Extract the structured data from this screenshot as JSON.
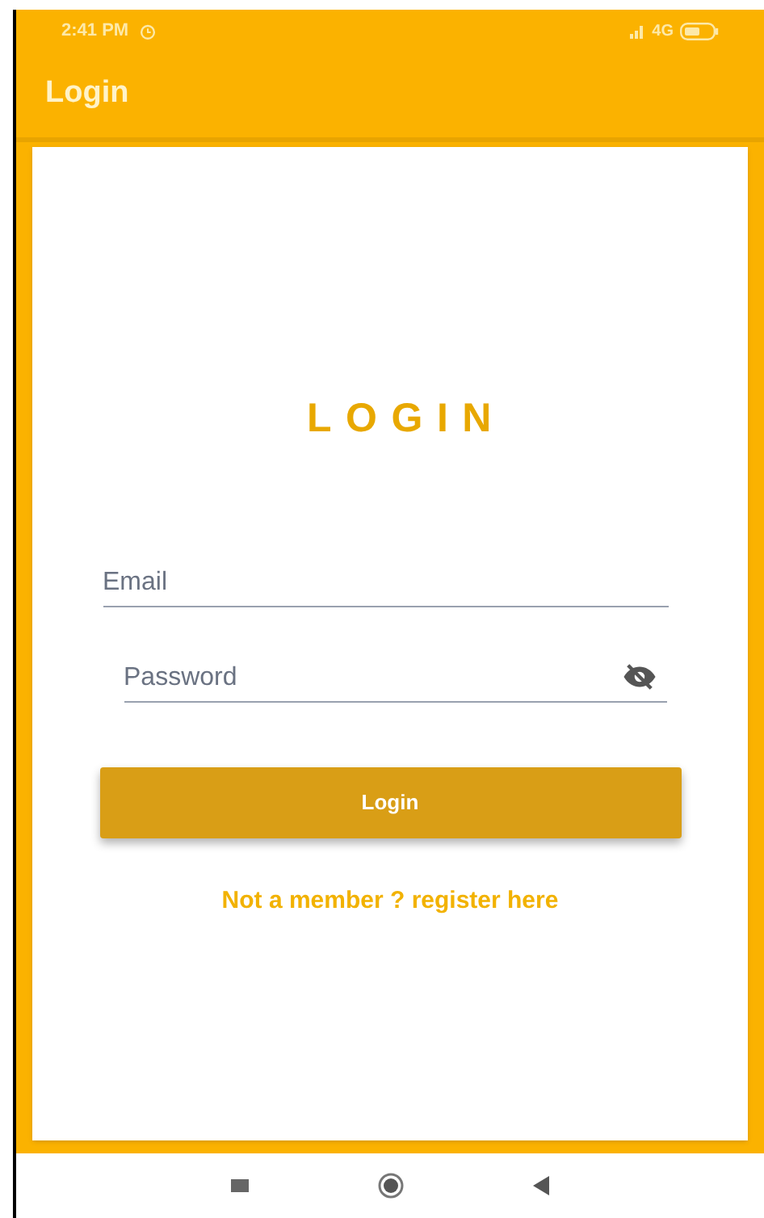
{
  "status_bar": {
    "time": "2:41 PM",
    "network": "4G"
  },
  "app_bar": {
    "title": "Login"
  },
  "form": {
    "heading": "LOGIN",
    "email": {
      "placeholder": "Email"
    },
    "password": {
      "placeholder": "Password",
      "visible": false
    },
    "submit": "Login",
    "register_link": "Not a member ? register here"
  }
}
